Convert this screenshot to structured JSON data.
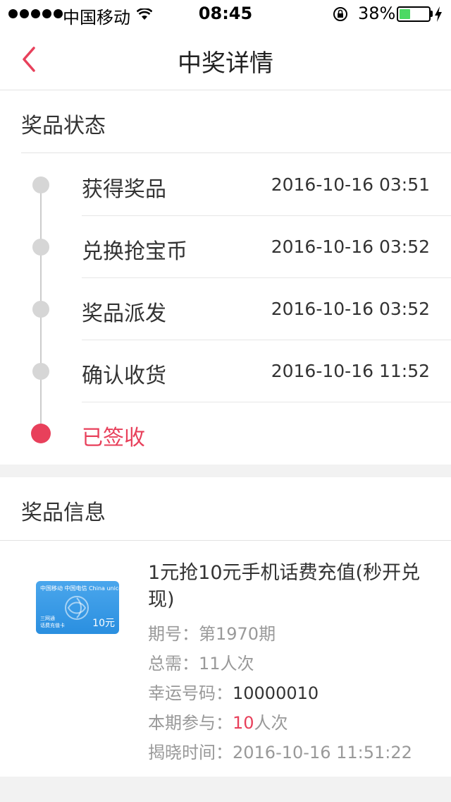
{
  "status_bar": {
    "carrier": "中国移动",
    "time": "08:45",
    "battery_percent": "38%",
    "battery_level": 0.38,
    "signal_bars": 5,
    "icons": [
      "wifi-icon",
      "orientation-lock-icon",
      "battery-icon",
      "charging-icon"
    ]
  },
  "nav": {
    "title": "中奖详情",
    "back_icon": "chevron-left-icon"
  },
  "status_section": {
    "title": "奖品状态",
    "steps": [
      {
        "label": "获得奖品",
        "time": "2016-10-16 03:51"
      },
      {
        "label": "兑换抢宝币",
        "time": "2016-10-16 03:52"
      },
      {
        "label": "奖品派发",
        "time": "2016-10-16 03:52"
      },
      {
        "label": "确认收货",
        "time": "2016-10-16 11:52"
      },
      {
        "label": "已签收",
        "time": ""
      }
    ],
    "active_index": 4
  },
  "info_section": {
    "title": "奖品信息",
    "prize_name": "1元抢10元手机话费充值(秒开兑现)",
    "card_image": {
      "logos_text": "中国移动 中国电信 China unicom中国联通",
      "sub_text_1": "三网通",
      "sub_text_2": "话费充值卡",
      "value_text": "10元"
    },
    "period": {
      "key": "期号：",
      "value": "第1970期"
    },
    "total_needed": {
      "key": "总需：",
      "value": "11人次"
    },
    "lucky_number": {
      "key": "幸运号码：",
      "value": "10000010"
    },
    "participation": {
      "key": "本期参与：",
      "count": "10",
      "unit": "人次"
    },
    "reveal_time": {
      "key": "揭晓时间：",
      "value": "2016-10-16 11:51:22"
    }
  },
  "colors": {
    "accent": "#e8405b",
    "inactive_dot": "#d6d6d6",
    "background": "#f2f2f2"
  }
}
